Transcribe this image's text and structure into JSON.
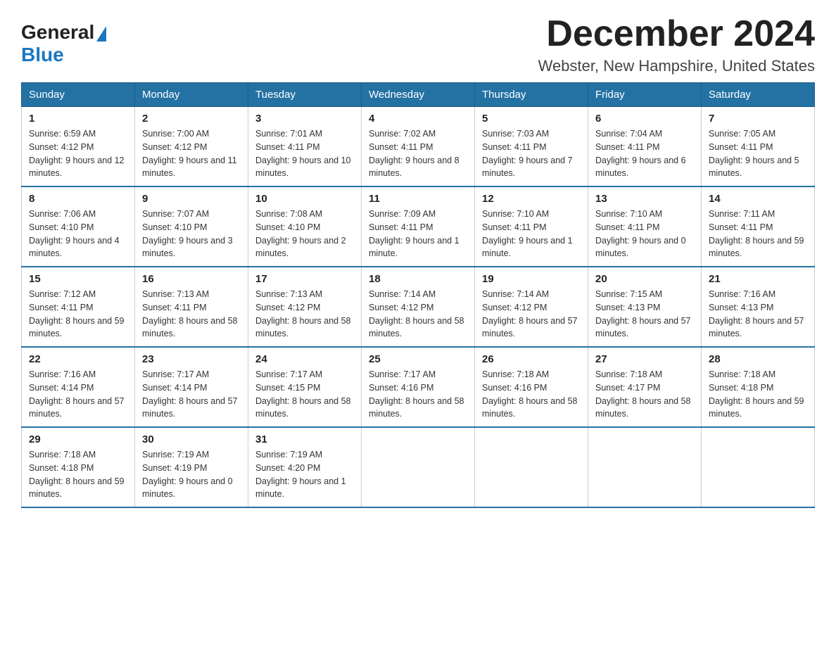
{
  "logo": {
    "text_general": "General",
    "text_blue": "Blue"
  },
  "title": {
    "month_year": "December 2024",
    "location": "Webster, New Hampshire, United States"
  },
  "days_of_week": [
    "Sunday",
    "Monday",
    "Tuesday",
    "Wednesday",
    "Thursday",
    "Friday",
    "Saturday"
  ],
  "weeks": [
    [
      {
        "day": "1",
        "sunrise": "6:59 AM",
        "sunset": "4:12 PM",
        "daylight": "9 hours and 12 minutes."
      },
      {
        "day": "2",
        "sunrise": "7:00 AM",
        "sunset": "4:12 PM",
        "daylight": "9 hours and 11 minutes."
      },
      {
        "day": "3",
        "sunrise": "7:01 AM",
        "sunset": "4:11 PM",
        "daylight": "9 hours and 10 minutes."
      },
      {
        "day": "4",
        "sunrise": "7:02 AM",
        "sunset": "4:11 PM",
        "daylight": "9 hours and 8 minutes."
      },
      {
        "day": "5",
        "sunrise": "7:03 AM",
        "sunset": "4:11 PM",
        "daylight": "9 hours and 7 minutes."
      },
      {
        "day": "6",
        "sunrise": "7:04 AM",
        "sunset": "4:11 PM",
        "daylight": "9 hours and 6 minutes."
      },
      {
        "day": "7",
        "sunrise": "7:05 AM",
        "sunset": "4:11 PM",
        "daylight": "9 hours and 5 minutes."
      }
    ],
    [
      {
        "day": "8",
        "sunrise": "7:06 AM",
        "sunset": "4:10 PM",
        "daylight": "9 hours and 4 minutes."
      },
      {
        "day": "9",
        "sunrise": "7:07 AM",
        "sunset": "4:10 PM",
        "daylight": "9 hours and 3 minutes."
      },
      {
        "day": "10",
        "sunrise": "7:08 AM",
        "sunset": "4:10 PM",
        "daylight": "9 hours and 2 minutes."
      },
      {
        "day": "11",
        "sunrise": "7:09 AM",
        "sunset": "4:11 PM",
        "daylight": "9 hours and 1 minute."
      },
      {
        "day": "12",
        "sunrise": "7:10 AM",
        "sunset": "4:11 PM",
        "daylight": "9 hours and 1 minute."
      },
      {
        "day": "13",
        "sunrise": "7:10 AM",
        "sunset": "4:11 PM",
        "daylight": "9 hours and 0 minutes."
      },
      {
        "day": "14",
        "sunrise": "7:11 AM",
        "sunset": "4:11 PM",
        "daylight": "8 hours and 59 minutes."
      }
    ],
    [
      {
        "day": "15",
        "sunrise": "7:12 AM",
        "sunset": "4:11 PM",
        "daylight": "8 hours and 59 minutes."
      },
      {
        "day": "16",
        "sunrise": "7:13 AM",
        "sunset": "4:11 PM",
        "daylight": "8 hours and 58 minutes."
      },
      {
        "day": "17",
        "sunrise": "7:13 AM",
        "sunset": "4:12 PM",
        "daylight": "8 hours and 58 minutes."
      },
      {
        "day": "18",
        "sunrise": "7:14 AM",
        "sunset": "4:12 PM",
        "daylight": "8 hours and 58 minutes."
      },
      {
        "day": "19",
        "sunrise": "7:14 AM",
        "sunset": "4:12 PM",
        "daylight": "8 hours and 57 minutes."
      },
      {
        "day": "20",
        "sunrise": "7:15 AM",
        "sunset": "4:13 PM",
        "daylight": "8 hours and 57 minutes."
      },
      {
        "day": "21",
        "sunrise": "7:16 AM",
        "sunset": "4:13 PM",
        "daylight": "8 hours and 57 minutes."
      }
    ],
    [
      {
        "day": "22",
        "sunrise": "7:16 AM",
        "sunset": "4:14 PM",
        "daylight": "8 hours and 57 minutes."
      },
      {
        "day": "23",
        "sunrise": "7:17 AM",
        "sunset": "4:14 PM",
        "daylight": "8 hours and 57 minutes."
      },
      {
        "day": "24",
        "sunrise": "7:17 AM",
        "sunset": "4:15 PM",
        "daylight": "8 hours and 58 minutes."
      },
      {
        "day": "25",
        "sunrise": "7:17 AM",
        "sunset": "4:16 PM",
        "daylight": "8 hours and 58 minutes."
      },
      {
        "day": "26",
        "sunrise": "7:18 AM",
        "sunset": "4:16 PM",
        "daylight": "8 hours and 58 minutes."
      },
      {
        "day": "27",
        "sunrise": "7:18 AM",
        "sunset": "4:17 PM",
        "daylight": "8 hours and 58 minutes."
      },
      {
        "day": "28",
        "sunrise": "7:18 AM",
        "sunset": "4:18 PM",
        "daylight": "8 hours and 59 minutes."
      }
    ],
    [
      {
        "day": "29",
        "sunrise": "7:18 AM",
        "sunset": "4:18 PM",
        "daylight": "8 hours and 59 minutes."
      },
      {
        "day": "30",
        "sunrise": "7:19 AM",
        "sunset": "4:19 PM",
        "daylight": "9 hours and 0 minutes."
      },
      {
        "day": "31",
        "sunrise": "7:19 AM",
        "sunset": "4:20 PM",
        "daylight": "9 hours and 1 minute."
      },
      null,
      null,
      null,
      null
    ]
  ]
}
